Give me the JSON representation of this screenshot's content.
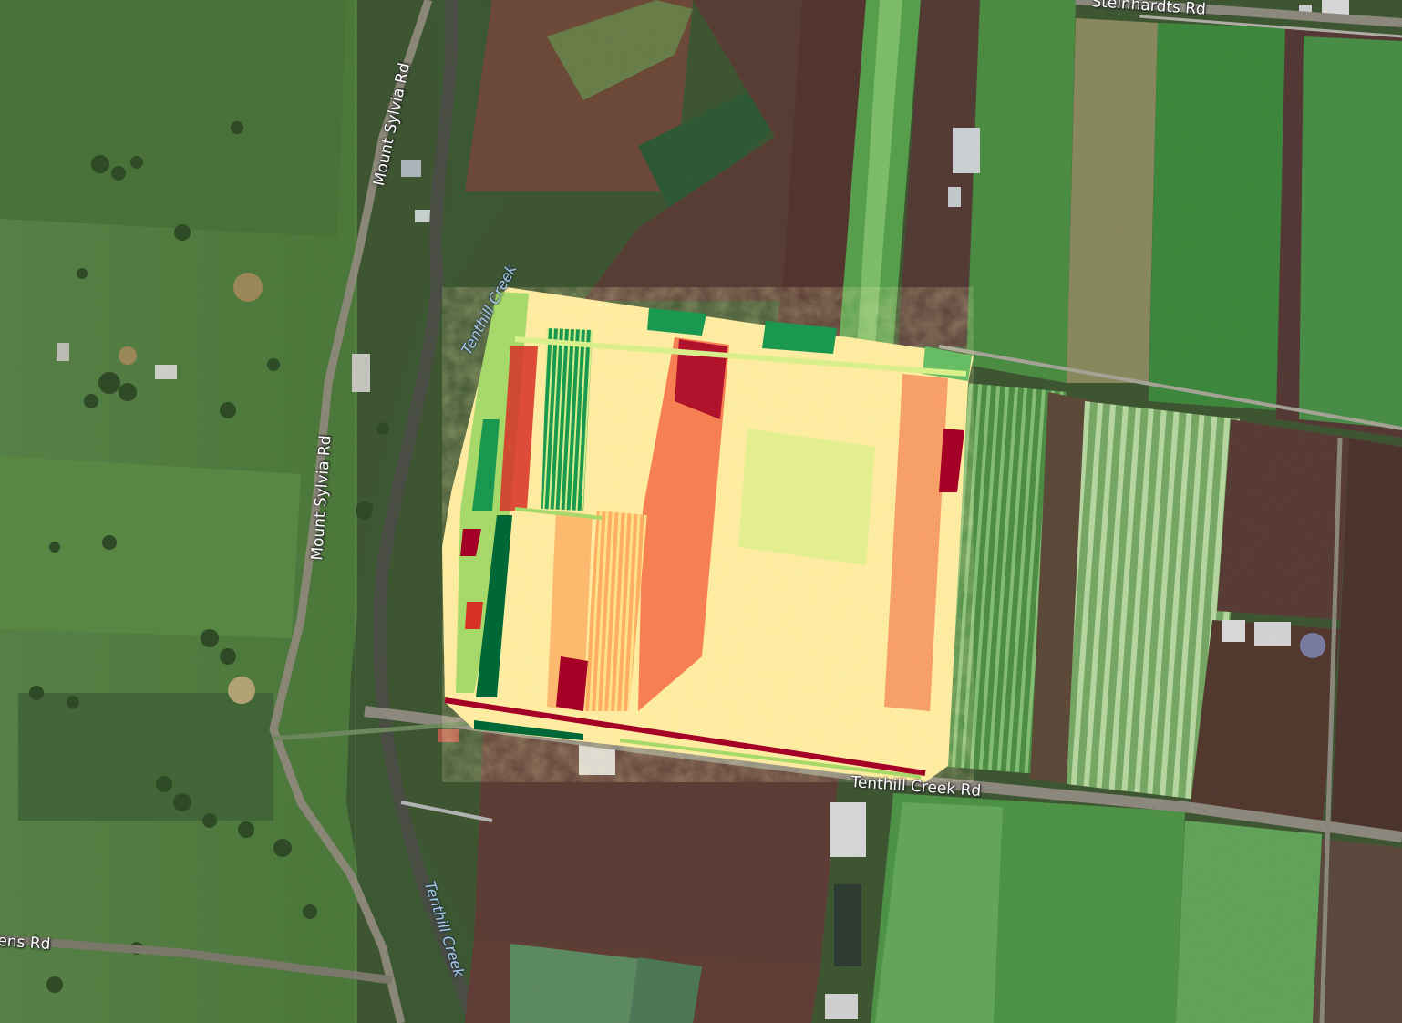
{
  "map": {
    "basemap": "satellite",
    "overlay": {
      "type": "vegetation-index-raster",
      "palette": [
        "#a50026",
        "#d73027",
        "#f46d43",
        "#fdae61",
        "#fee08b",
        "#ffffbf",
        "#d9ef8b",
        "#a6d96a",
        "#66bd63",
        "#1a9850",
        "#006837"
      ]
    },
    "labels": {
      "road_1": "Mount Sylvia Rd",
      "road_2": "Mount Sylvia Rd",
      "road_3": "Steinhardts Rd",
      "road_4": "Tenthill Creek Rd",
      "road_5": "ens Rd",
      "creek_1": "Tenthill Creek",
      "creek_2": "Tenthill Creek"
    }
  }
}
